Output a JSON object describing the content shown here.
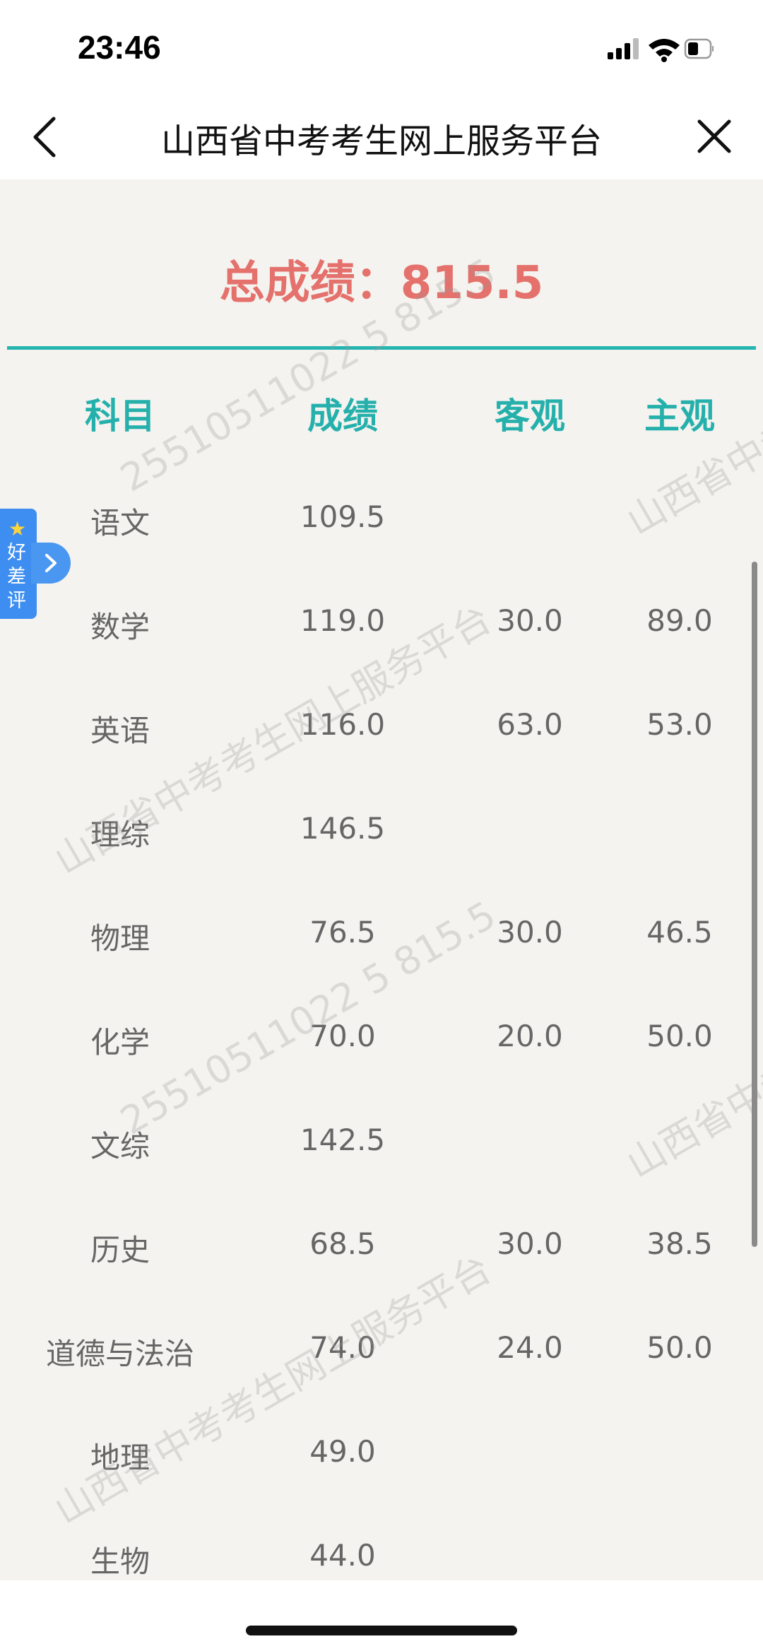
{
  "status_bar": {
    "time": "23:46"
  },
  "nav": {
    "title": "山西省中考考生网上服务平台"
  },
  "total": {
    "label": "总成绩：",
    "value": "815.5"
  },
  "table": {
    "headers": [
      "科目",
      "成绩",
      "客观",
      "主观"
    ],
    "rows": [
      {
        "subject": "语文",
        "score": "109.5",
        "objective": "",
        "subjective": ""
      },
      {
        "subject": "数学",
        "score": "119.0",
        "objective": "30.0",
        "subjective": "89.0"
      },
      {
        "subject": "英语",
        "score": "116.0",
        "objective": "63.0",
        "subjective": "53.0"
      },
      {
        "subject": "理综",
        "score": "146.5",
        "objective": "",
        "subjective": ""
      },
      {
        "subject": "物理",
        "score": "76.5",
        "objective": "30.0",
        "subjective": "46.5"
      },
      {
        "subject": "化学",
        "score": "70.0",
        "objective": "20.0",
        "subjective": "50.0"
      },
      {
        "subject": "文综",
        "score": "142.5",
        "objective": "",
        "subjective": ""
      },
      {
        "subject": "历史",
        "score": "68.5",
        "objective": "30.0",
        "subjective": "38.5"
      },
      {
        "subject": "道德与法治",
        "score": "74.0",
        "objective": "24.0",
        "subjective": "50.0"
      },
      {
        "subject": "地理",
        "score": "49.0",
        "objective": "",
        "subjective": ""
      },
      {
        "subject": "生物",
        "score": "44.0",
        "objective": "",
        "subjective": ""
      }
    ]
  },
  "watermarks": {
    "platform": "山西省中考考生网上服务平台",
    "id_score": "25510511022 5 815.5"
  },
  "side_widget": {
    "label": "好差评",
    "icons": [
      "star-icon",
      "chevron-right-icon"
    ]
  },
  "colors": {
    "accent": "#25b0ac",
    "total": "#e5716c",
    "widget": "#3d8ef0"
  }
}
